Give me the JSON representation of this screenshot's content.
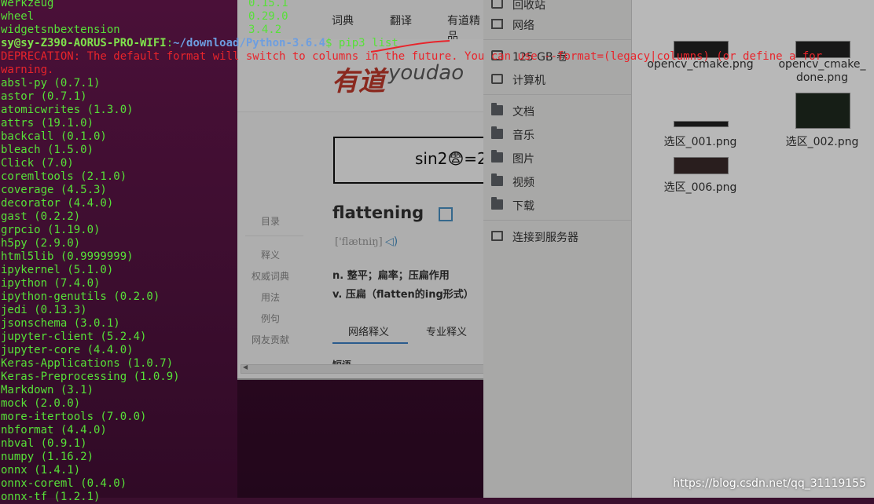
{
  "terminal": {
    "top_packages": [
      {
        "name": "Werkzeug",
        "version": "0.15.1"
      },
      {
        "name": "wheel",
        "version": "0.29.0"
      },
      {
        "name": "widgetsnbextension",
        "version": "3.4.2"
      }
    ],
    "prompt_user": "sy@sy-Z390-AORUS-PRO-WIFI",
    "prompt_sep": ":",
    "prompt_path": "~/download/Python-3.6.4",
    "prompt_symbol": "$",
    "command": " pip3 list",
    "deprecation_line1": "DEPRECATION: The default format will switch to columns in the future. You can use --format=(legacy|columns) (or define a for",
    "deprecation_line2": "warning.",
    "packages": [
      "absl-py (0.7.1)",
      "astor (0.7.1)",
      "atomicwrites (1.3.0)",
      "attrs (19.1.0)",
      "backcall (0.1.0)",
      "bleach (1.5.0)",
      "Click (7.0)",
      "coremltools (2.1.0)",
      "coverage (4.5.3)",
      "decorator (4.4.0)",
      "gast (0.2.2)",
      "grpcio (1.19.0)",
      "h5py (2.9.0)",
      "html5lib (0.9999999)",
      "ipykernel (5.1.0)",
      "ipython (7.4.0)",
      "ipython-genutils (0.2.0)",
      "jedi (0.13.3)",
      "jsonschema (3.0.1)",
      "jupyter-client (5.2.4)",
      "jupyter-core (4.4.0)",
      "Keras-Applications (1.0.7)",
      "Keras-Preprocessing (1.0.9)",
      "Markdown (3.1)",
      "mock (2.0.0)",
      "more-itertools (7.0.0)",
      "nbformat (4.4.0)",
      "nbval (0.9.1)",
      "numpy (1.16.2)",
      "onnx (1.4.1)",
      "onnx-coreml (0.4.0)",
      "onnx-tf (1.2.1)"
    ],
    "colors": {
      "green": "#57e138",
      "red": "#e8242b",
      "path_blue": "#6d9ee0"
    }
  },
  "browser": {
    "nav": [
      "词典",
      "翻译",
      "有道精品"
    ],
    "logo_cn": "有道",
    "logo_en": "youdao",
    "captcha_text": "sin2😨=2",
    "side_menu": [
      "目录",
      "释义",
      "权威词典",
      "用法",
      "例句",
      "网友贡献"
    ],
    "word": "flattening",
    "phonetic": "['flætniŋ]",
    "definitions": [
      "n. 整平；扁率；压扁作用",
      "v. 压扁（flatten的ing形式）"
    ],
    "tabs": [
      "网络释义",
      "专业释义"
    ],
    "sub_heading": "短语"
  },
  "file_manager": {
    "sidebar": [
      {
        "label": "回收站",
        "icon": "trash-icon"
      },
      {
        "label": "网络",
        "icon": "network-icon"
      },
      {
        "label": "125 GB 卷",
        "icon": "drive-icon"
      },
      {
        "label": "计算机",
        "icon": "computer-icon"
      },
      {
        "label": "文档",
        "icon": "folder-icon"
      },
      {
        "label": "音乐",
        "icon": "folder-icon"
      },
      {
        "label": "图片",
        "icon": "folder-icon"
      },
      {
        "label": "视频",
        "icon": "folder-icon"
      },
      {
        "label": "下载",
        "icon": "folder-icon"
      },
      {
        "label": "连接到服务器",
        "icon": "server-icon"
      }
    ],
    "files": [
      {
        "name": "opencv_cmake.png"
      },
      {
        "name": "opencv_cmake_\ndone.png"
      },
      {
        "name": "选区_001.png"
      },
      {
        "name": "选区_002.png"
      },
      {
        "name": "选区_006.png"
      }
    ]
  },
  "watermark": "https://blog.csdn.net/qq_31119155"
}
